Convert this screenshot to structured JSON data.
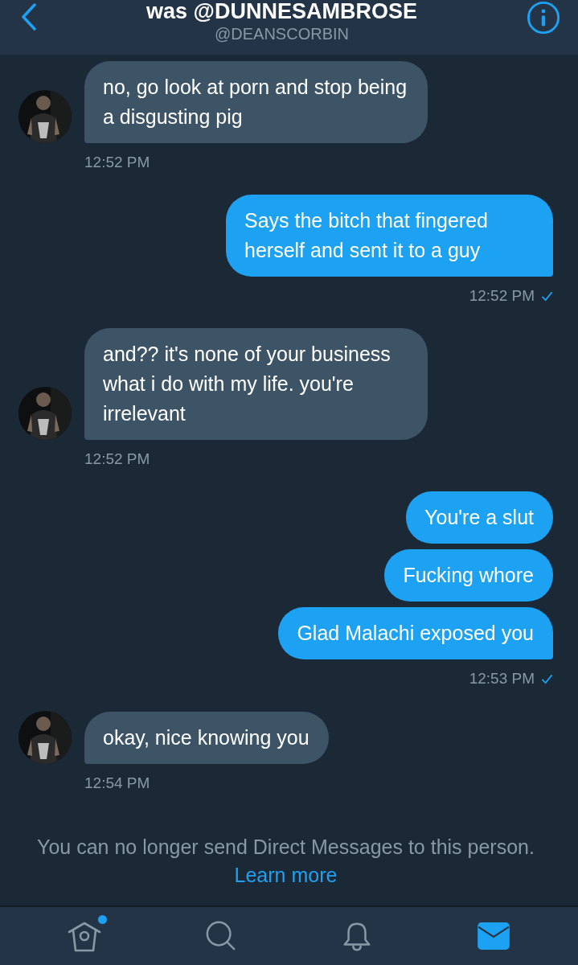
{
  "header": {
    "title": "was @DUNNESAMBROSE",
    "subtitle": "@DEANSCORBIN"
  },
  "groups": [
    {
      "kind": "incoming",
      "bubbles": [
        "no, go look at porn and stop being a disgusting pig"
      ],
      "time": "12:52 PM"
    },
    {
      "kind": "outgoing",
      "bubbles": [
        "Says the bitch that fingered herself and sent it to a guy"
      ],
      "time": "12:52 PM",
      "read": true
    },
    {
      "kind": "incoming",
      "bubbles": [
        "and?? it's none of your business what i do with my life. you're irrelevant"
      ],
      "time": "12:52 PM"
    },
    {
      "kind": "outgoing",
      "bubbles": [
        "You're a slut",
        "Fucking whore",
        "Glad Malachi exposed you"
      ],
      "time": "12:53 PM",
      "read": true
    },
    {
      "kind": "incoming",
      "bubbles": [
        "okay, nice knowing you"
      ],
      "time": "12:54 PM"
    }
  ],
  "notice": {
    "text": "You can no longer send Direct Messages to this person. ",
    "link": "Learn more"
  },
  "tabs": [
    {
      "kind": "home",
      "selected": false,
      "dot": true
    },
    {
      "kind": "search",
      "selected": false,
      "dot": false
    },
    {
      "kind": "notifications",
      "selected": false,
      "dot": false
    },
    {
      "kind": "messages",
      "selected": true,
      "dot": false
    }
  ]
}
